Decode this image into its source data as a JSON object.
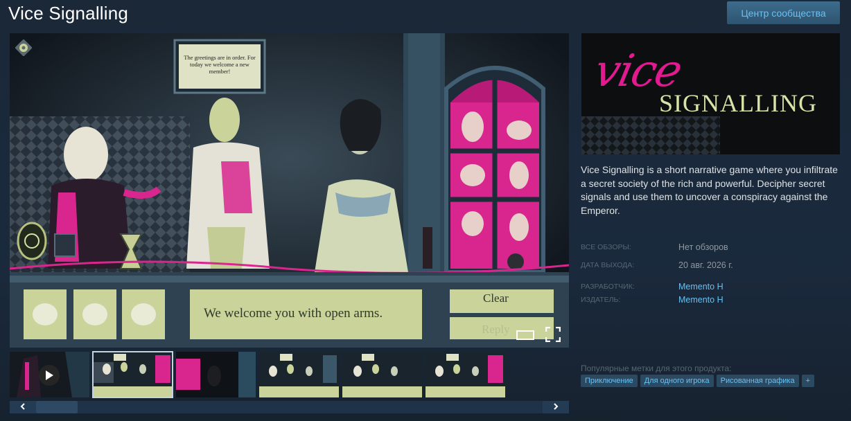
{
  "header": {
    "title": "Vice Signalling",
    "community_button": "Центр сообщества"
  },
  "media": {
    "sign_text": "The greetings are in order. For today we welcome a new member!",
    "subtitle": "We welcome you with open arms.",
    "clear_label": "Clear",
    "reply_label": "Reply",
    "fullscreen_icon": "fullscreen-icon",
    "settings_icon": "gear-icon"
  },
  "capsule": {
    "logo_top": "vice",
    "logo_bottom": "SIGNALLING"
  },
  "description": "Vice Signalling is a short narrative game where you infiltrate a secret society of the rich and powerful. Decipher secret signals and use them to uncover a conspiracy against the Emperor.",
  "details": {
    "reviews_label": "ВСЕ ОБЗОРЫ:",
    "reviews_value": "Нет обзоров",
    "release_label": "ДАТА ВЫХОДА:",
    "release_value": "20 авг. 2026 г.",
    "developer_label": "РАЗРАБОТЧИК:",
    "developer_value": "Memento H",
    "publisher_label": "ИЗДАТЕЛЬ:",
    "publisher_value": "Memento H"
  },
  "tags": {
    "label": "Популярные метки для этого продукта:",
    "items": [
      "Приключение",
      "Для одного игрока",
      "Рисованная графика",
      "+"
    ]
  },
  "colors": {
    "accent": "#67c1f5",
    "magenta": "#e11b8f",
    "pale_green": "#d9e3a7"
  }
}
